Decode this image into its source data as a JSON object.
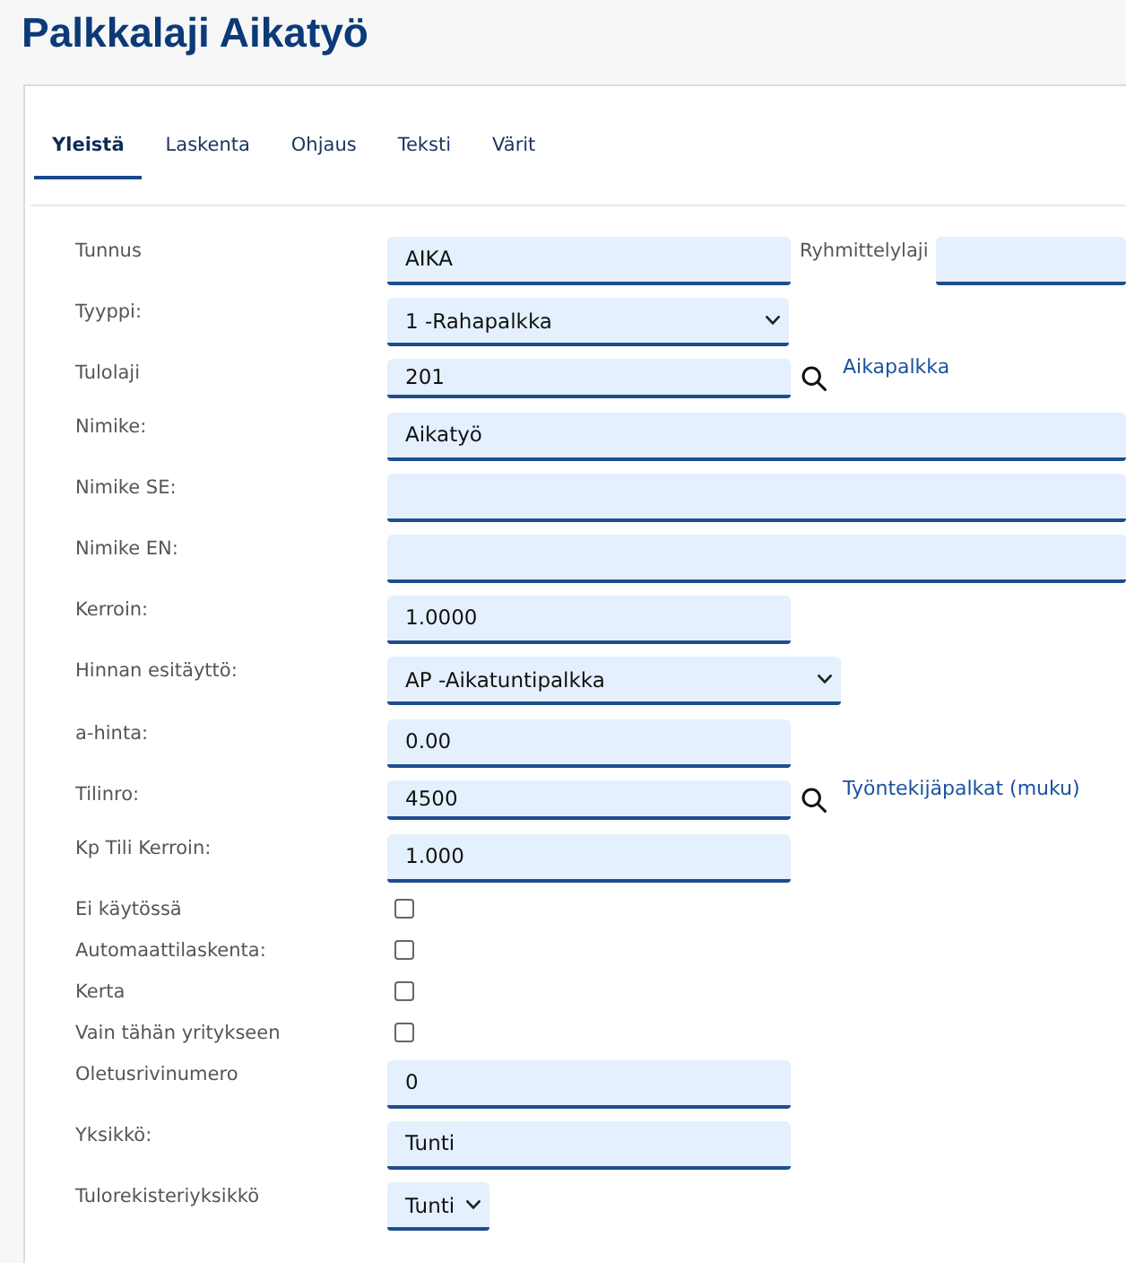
{
  "title": "Palkkalaji Aikatyö",
  "tabs": [
    {
      "label": "Yleistä",
      "selected": true
    },
    {
      "label": "Laskenta",
      "selected": false
    },
    {
      "label": "Ohjaus",
      "selected": false
    },
    {
      "label": "Teksti",
      "selected": false
    },
    {
      "label": "Värit",
      "selected": false
    }
  ],
  "sections": [
    {
      "fields": [
        {
          "kind": "text",
          "label": "Tunnus",
          "value": "AIKA",
          "side": {
            "label": "Ryhmittelylaji"
          }
        },
        {
          "kind": "select",
          "label": "Tyyppi:",
          "value": "1 -Rahapalkka"
        },
        {
          "kind": "lookup",
          "label": "Tulolaji",
          "value": "201",
          "link": "Aikapalkka"
        },
        {
          "kind": "wide-text",
          "label": "Nimike:",
          "value": "Aikatyö"
        },
        {
          "kind": "wide-text",
          "label": "Nimike SE:"
        },
        {
          "kind": "wide-text",
          "label": "Nimike EN:"
        },
        {
          "kind": "text",
          "label": "Kerroin:",
          "value": "1.0000"
        },
        {
          "kind": "select",
          "label": "Hinnan esitäyttö:",
          "value": "AP -Aikatuntipalkka"
        }
      ]
    },
    {
      "fields": [
        {
          "kind": "text",
          "label": "a-hinta:",
          "value": "0.00"
        },
        {
          "kind": "lookup",
          "label": "Tilinro:",
          "value": "4500",
          "link": "Työntekijäpalkat (muku)"
        },
        {
          "kind": "text",
          "label": "Kp Tili Kerroin:",
          "value": "1.000"
        },
        {
          "kind": "checkbox",
          "label": "Ei käytössä",
          "checked": false
        },
        {
          "kind": "checkbox",
          "label": "Automaattilaskenta:",
          "checked": false
        },
        {
          "kind": "checkbox",
          "label": "Kerta",
          "checked": false
        },
        {
          "kind": "checkbox",
          "label": "Vain tähän yritykseen",
          "checked": false
        },
        {
          "kind": "text",
          "label": "Oletusrivinumero",
          "value": "0"
        },
        {
          "kind": "text",
          "label": "Yksikkö:",
          "value": "Tunti"
        },
        {
          "kind": "short-select",
          "label": "Tulorekisteriyksikkö",
          "value": "Tunti"
        }
      ]
    }
  ]
}
